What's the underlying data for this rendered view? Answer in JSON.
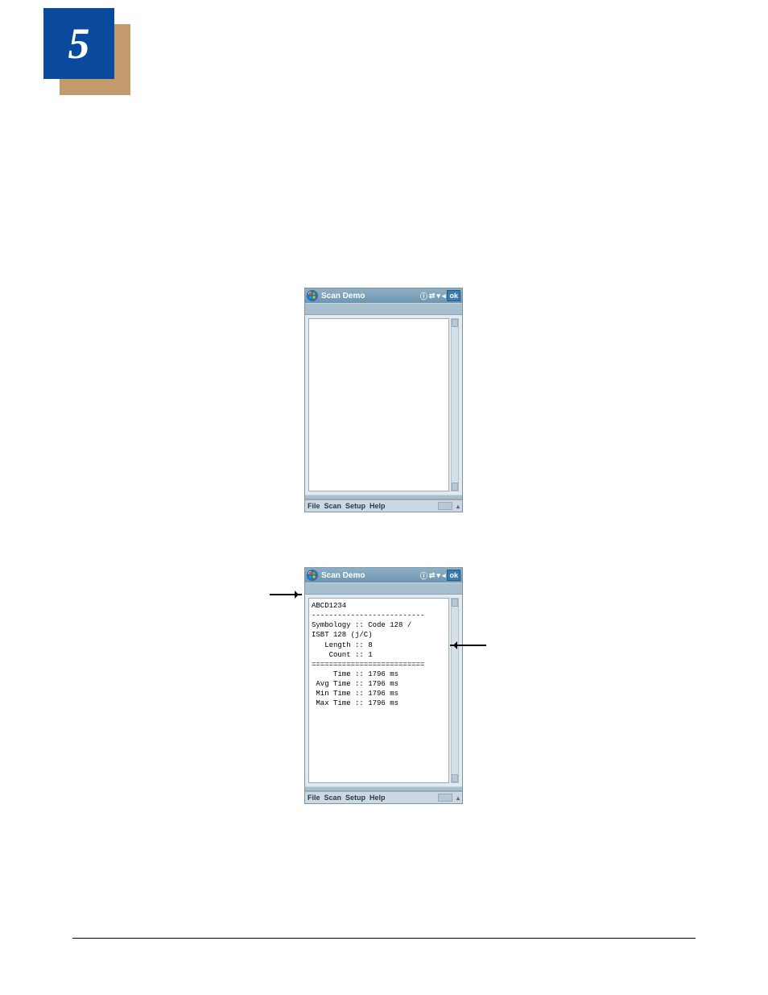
{
  "chapter_number": "5",
  "device1": {
    "title": "Scan Demo",
    "ok": "ok",
    "menu": {
      "file": "File",
      "scan": "Scan",
      "setup": "Setup",
      "help": "Help"
    }
  },
  "device2": {
    "title": "Scan Demo",
    "ok": "ok",
    "menu": {
      "file": "File",
      "scan": "Scan",
      "setup": "Setup",
      "help": "Help"
    },
    "pane_text": "ABCD1234\n--------------------------\nSymbology :: Code 128 /\nISBT 128 (j/C)\n   Length :: 8\n    Count :: 1\n==========================\n     Time :: 1796 ms\n Avg Time :: 1796 ms\n Min Time :: 1796 ms\n Max Time :: 1796 ms"
  }
}
